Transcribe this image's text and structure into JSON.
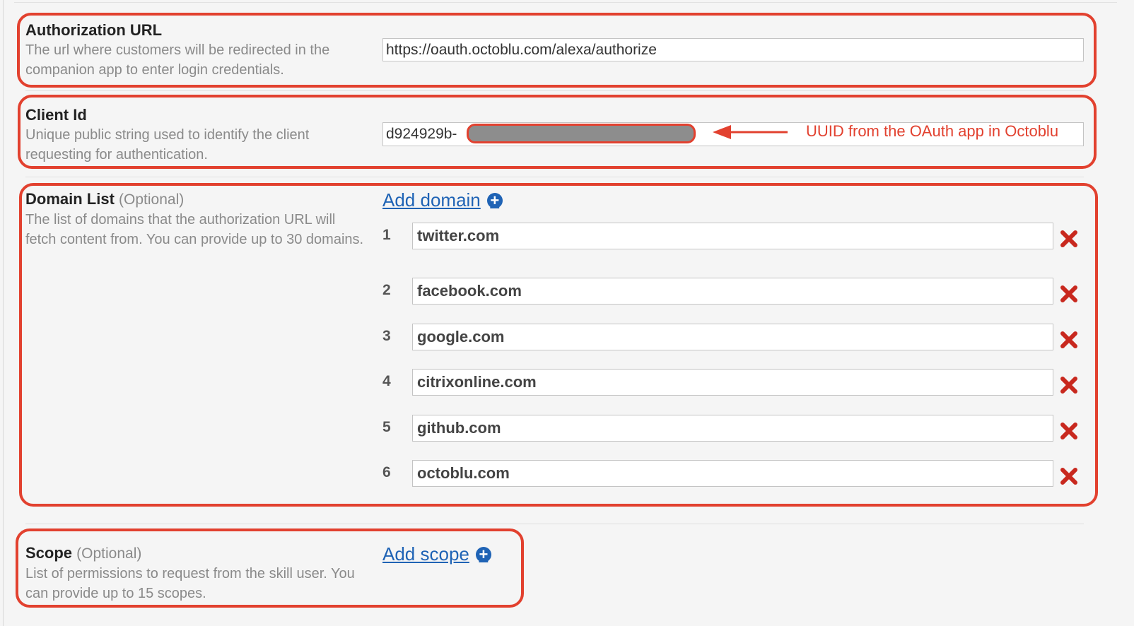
{
  "auth_url": {
    "title": "Authorization URL",
    "description": "The url where customers will be redirected in the companion app to enter login credentials.",
    "value": "https://oauth.octoblu.com/alexa/authorize"
  },
  "client_id": {
    "title": "Client Id",
    "description": "Unique public string used to identify the client requesting for authentication.",
    "value_visible": "d924929b-",
    "annotation": "UUID from the OAuth app in Octoblu"
  },
  "domain_list": {
    "title": "Domain List",
    "optional": "(Optional)",
    "description": "The list of domains that the authorization URL will fetch content from. You can provide up to 30 domains.",
    "add_label": "Add domain",
    "domains": [
      {
        "num": "1",
        "value": "twitter.com"
      },
      {
        "num": "2",
        "value": "facebook.com"
      },
      {
        "num": "3",
        "value": "google.com"
      },
      {
        "num": "4",
        "value": "citrixonline.com"
      },
      {
        "num": "5",
        "value": "github.com"
      },
      {
        "num": "6",
        "value": "octoblu.com"
      }
    ]
  },
  "scope": {
    "title": "Scope",
    "optional": "(Optional)",
    "description": "List of permissions to request from the skill user. You can provide up to 15 scopes.",
    "add_label": "Add scope"
  },
  "colors": {
    "annotation_red": "#e2412f",
    "link_blue": "#1f63b5",
    "delete_red": "#c8281e"
  },
  "icons": {
    "add": "plus-circle-icon",
    "delete": "delete-x-icon",
    "arrow": "arrow-left-icon"
  }
}
